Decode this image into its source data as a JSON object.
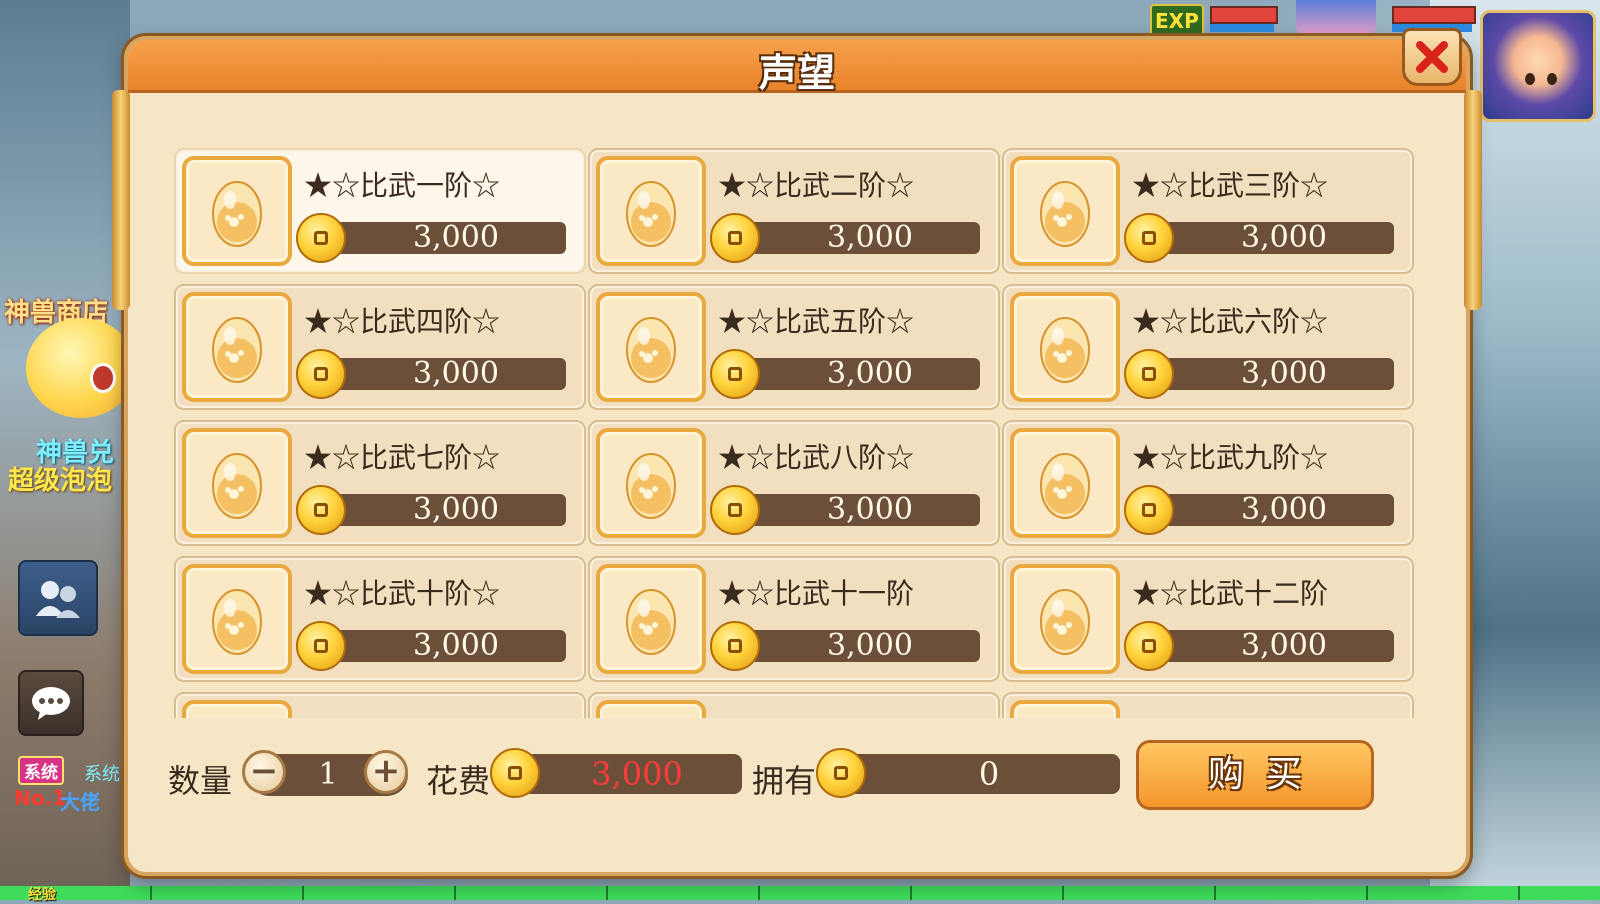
{
  "dialog": {
    "title": "声望"
  },
  "items": [
    {
      "name": "★☆比武一阶☆",
      "price": "3,000",
      "selected": true
    },
    {
      "name": "★☆比武二阶☆",
      "price": "3,000"
    },
    {
      "name": "★☆比武三阶☆",
      "price": "3,000"
    },
    {
      "name": "★☆比武四阶☆",
      "price": "3,000"
    },
    {
      "name": "★☆比武五阶☆",
      "price": "3,000"
    },
    {
      "name": "★☆比武六阶☆",
      "price": "3,000"
    },
    {
      "name": "★☆比武七阶☆",
      "price": "3,000"
    },
    {
      "name": "★☆比武八阶☆",
      "price": "3,000"
    },
    {
      "name": "★☆比武九阶☆",
      "price": "3,000"
    },
    {
      "name": "★☆比武十阶☆",
      "price": "3,000"
    },
    {
      "name": "★☆比武十一阶",
      "price": "3,000"
    },
    {
      "name": "★☆比武十二阶",
      "price": "3,000"
    },
    {
      "name": "",
      "price": ""
    },
    {
      "name": "",
      "price": ""
    },
    {
      "name": "",
      "price": ""
    }
  ],
  "purchase": {
    "quantity_label": "数量",
    "quantity": "1",
    "cost_label": "花费",
    "cost": "3,000",
    "owned_label": "拥有",
    "owned": "0",
    "buy_label": "购买"
  },
  "hud": {
    "exp_badge": "EXP",
    "shop_label": "神兽商店",
    "side_text_1": "神兽兑",
    "side_text_2": "超级泡泡",
    "system_tag": "系统",
    "system_text": "系统",
    "rank_text": "No.1",
    "rank_text_2": "大佬",
    "exp_bar_label": "经验"
  },
  "colors": {
    "accent": "#f3962b",
    "panel": "#f6e6c6",
    "price_bg": "#6b4f38",
    "cost_text": "#ff3b3b"
  },
  "icons": {
    "close": "close-x-icon",
    "coin": "gold-coin-icon",
    "item": "egg-icon"
  }
}
